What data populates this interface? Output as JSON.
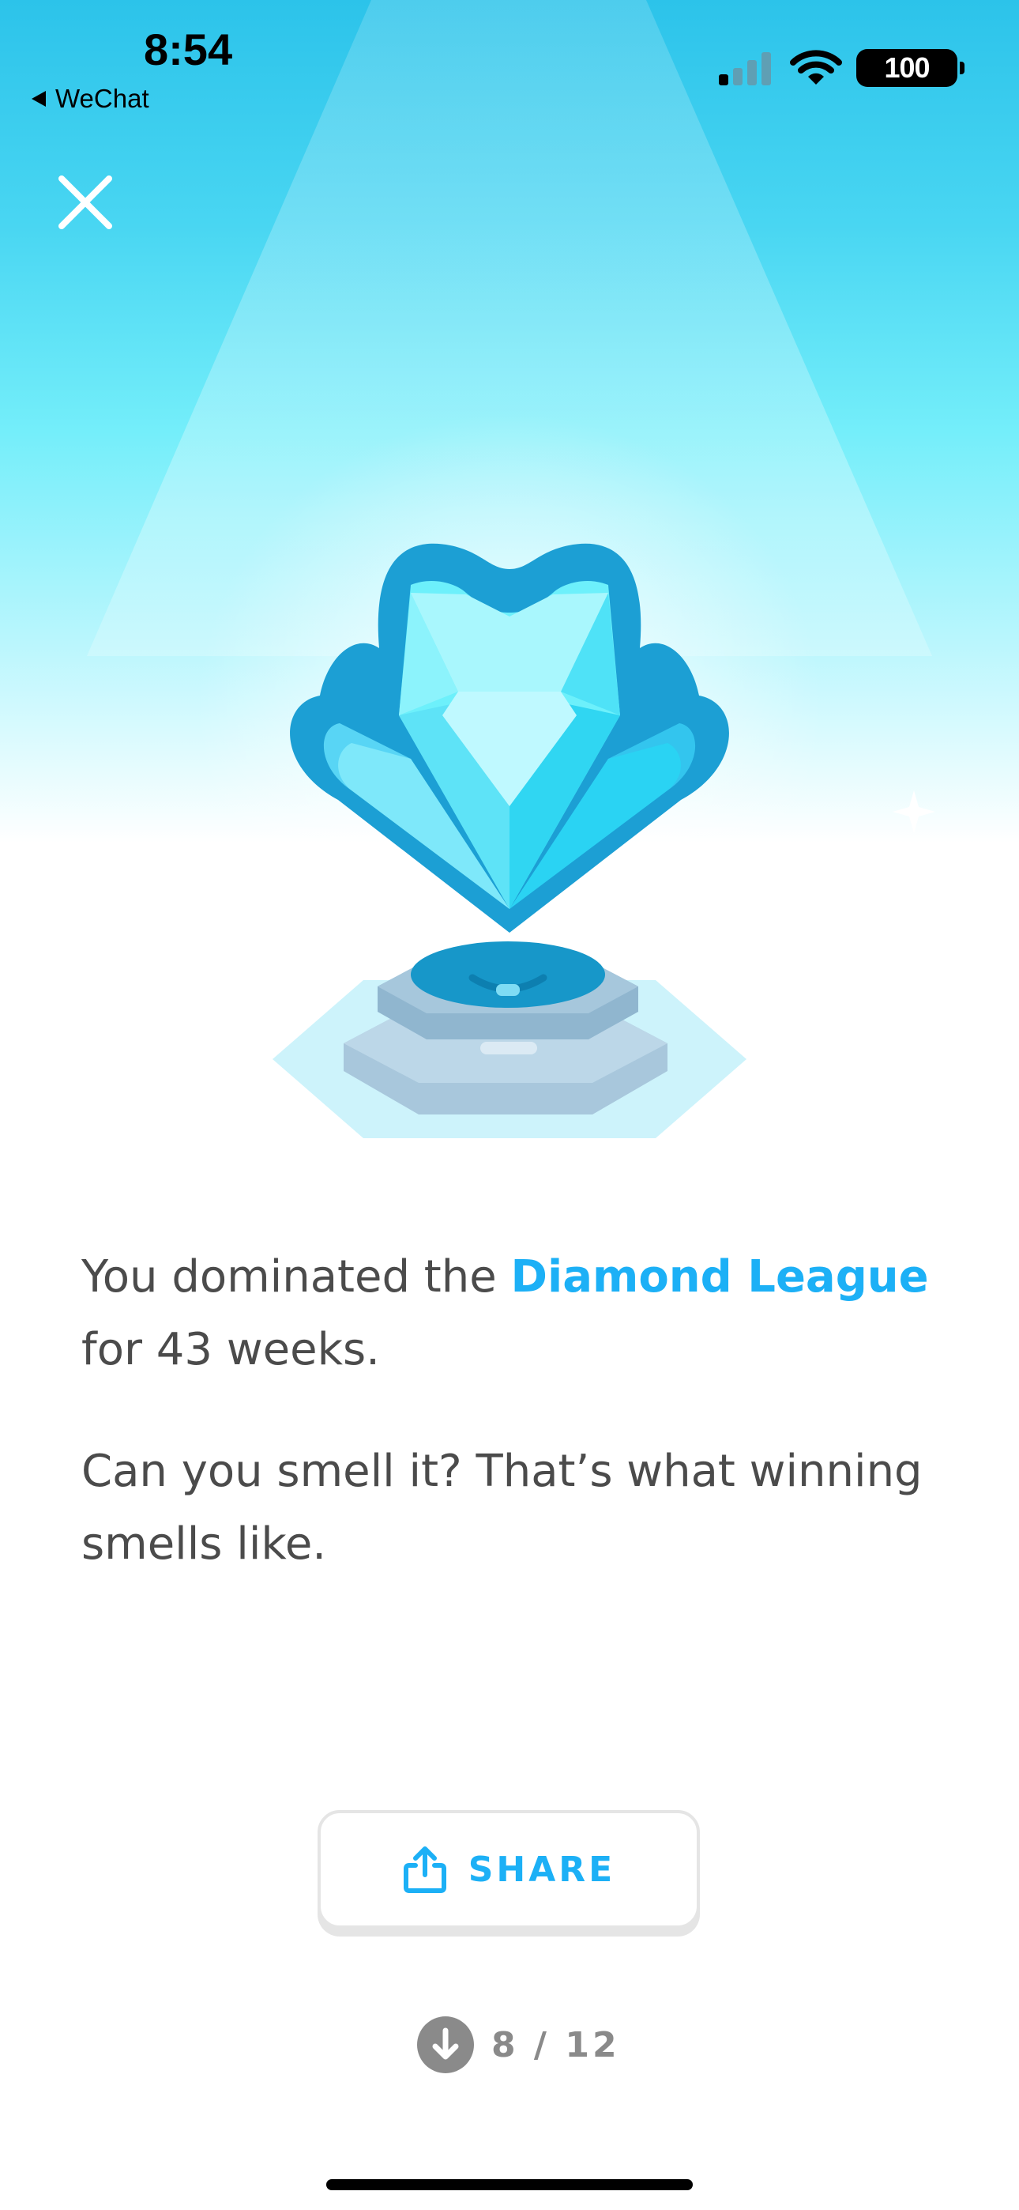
{
  "status_bar": {
    "time": "8:54",
    "back_app": "WeChat",
    "battery": "100"
  },
  "message": {
    "line1_prefix": "You dominated the ",
    "league": "Diamond League",
    "line1_suffix": "for 43 weeks.",
    "line2": "Can you smell it? That’s what winning smells like."
  },
  "share": {
    "label": "SHARE"
  },
  "pager": {
    "text": "8 / 12"
  },
  "colors": {
    "accent": "#1cb0f6",
    "sky_top": "#2cc3ea",
    "sky_mid": "#74eefa"
  },
  "icons": {
    "close": "close-icon",
    "share": "share-icon",
    "next": "arrow-down-icon",
    "trophy": "diamond-trophy-icon",
    "sparkle": "sparkle-icon"
  }
}
